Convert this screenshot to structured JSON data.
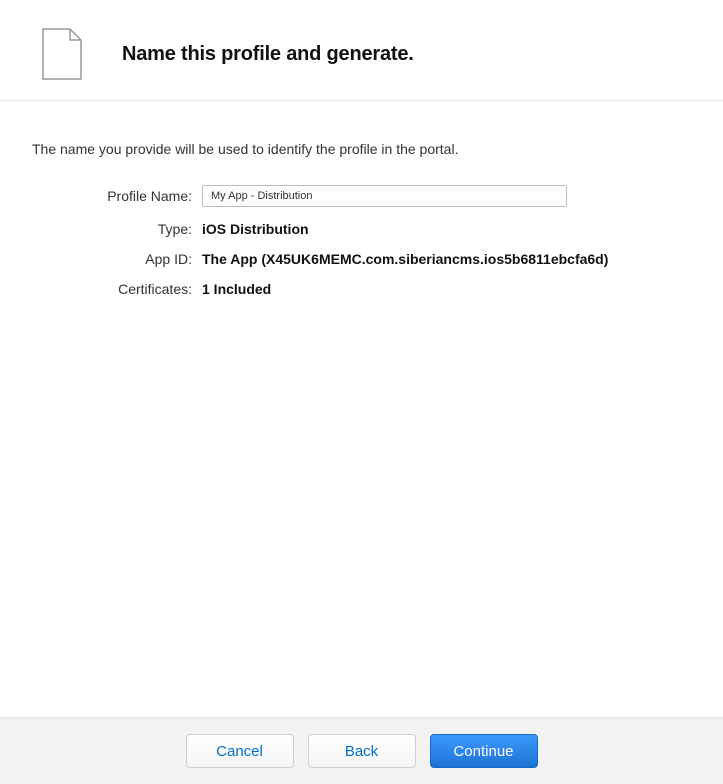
{
  "header": {
    "title": "Name this profile and generate."
  },
  "description": "The name you provide will be used to identify the profile in the portal.",
  "form": {
    "profile_name": {
      "label": "Profile Name:",
      "value": "My App - Distribution"
    },
    "type": {
      "label": "Type:",
      "value": "iOS Distribution"
    },
    "app_id": {
      "label": "App ID:",
      "value": "The App (X45UK6MEMC.com.siberiancms.ios5b6811ebcfa6d)"
    },
    "certificates": {
      "label": "Certificates:",
      "value": "1 Included"
    }
  },
  "footer": {
    "cancel": "Cancel",
    "back": "Back",
    "continue": "Continue"
  }
}
